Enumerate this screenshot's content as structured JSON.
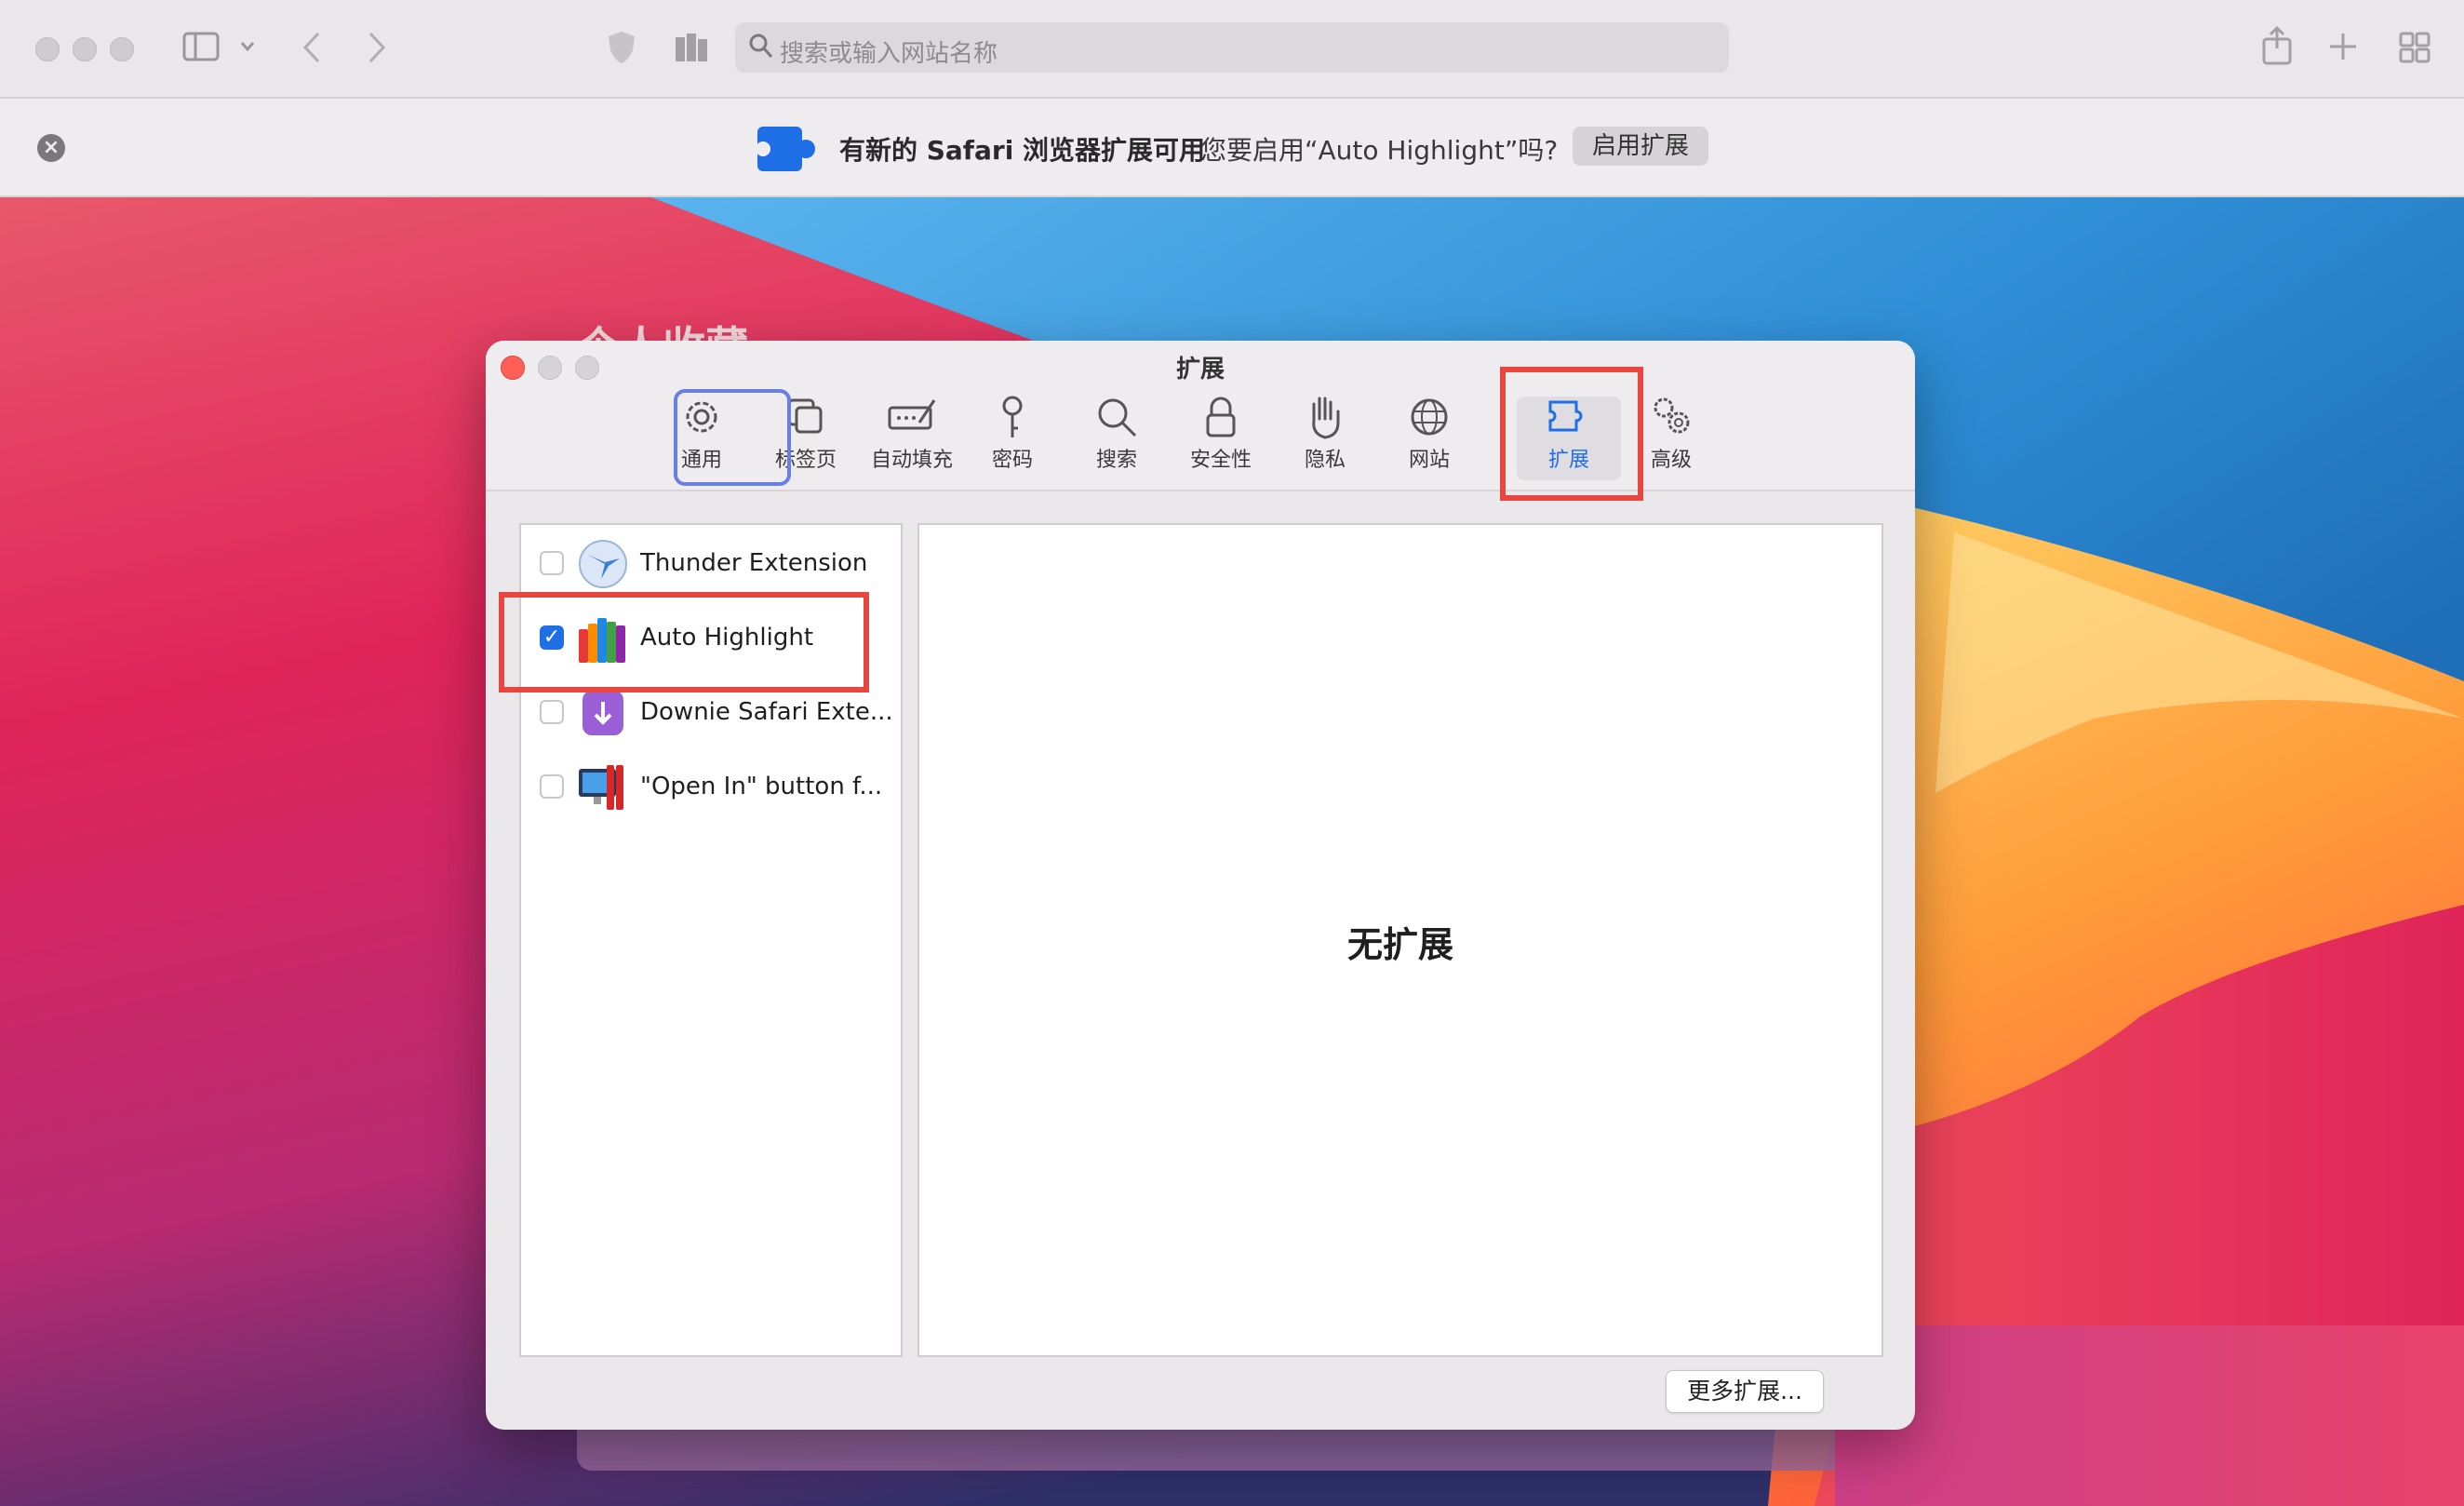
{
  "toolbar": {
    "url_placeholder": "搜索或输入网站名称"
  },
  "banner": {
    "title": "有新的 Safari 浏览器扩展可用",
    "question": "您要启用“Auto Highlight”吗?",
    "enable_button": "启用扩展"
  },
  "wallpaper": {
    "label": "个人收藏"
  },
  "window": {
    "title": "扩展",
    "tabs": [
      {
        "label": "通用",
        "icon": "gear-icon"
      },
      {
        "label": "标签页",
        "icon": "tabs-icon"
      },
      {
        "label": "自动填充",
        "icon": "autofill-icon"
      },
      {
        "label": "密码",
        "icon": "key-icon"
      },
      {
        "label": "搜索",
        "icon": "search-icon"
      },
      {
        "label": "安全性",
        "icon": "lock-icon"
      },
      {
        "label": "隐私",
        "icon": "hand-icon"
      },
      {
        "label": "网站",
        "icon": "globe-icon"
      },
      {
        "label": "扩展",
        "icon": "puzzle-icon",
        "active": true
      },
      {
        "label": "高级",
        "icon": "gears-icon"
      }
    ],
    "extensions": [
      {
        "name": "Thunder Extension",
        "enabled": false
      },
      {
        "name": "Auto Highlight",
        "enabled": true
      },
      {
        "name": "Downie Safari Exte...",
        "enabled": false
      },
      {
        "name": "\"Open In\" button f...",
        "enabled": false
      }
    ],
    "empty_text": "无扩展",
    "more_button": "更多扩展..."
  },
  "colors": {
    "accent": "#1e6fe6",
    "highlight_red": "#e8473f",
    "highlight_blue": "#6b7fe0"
  }
}
